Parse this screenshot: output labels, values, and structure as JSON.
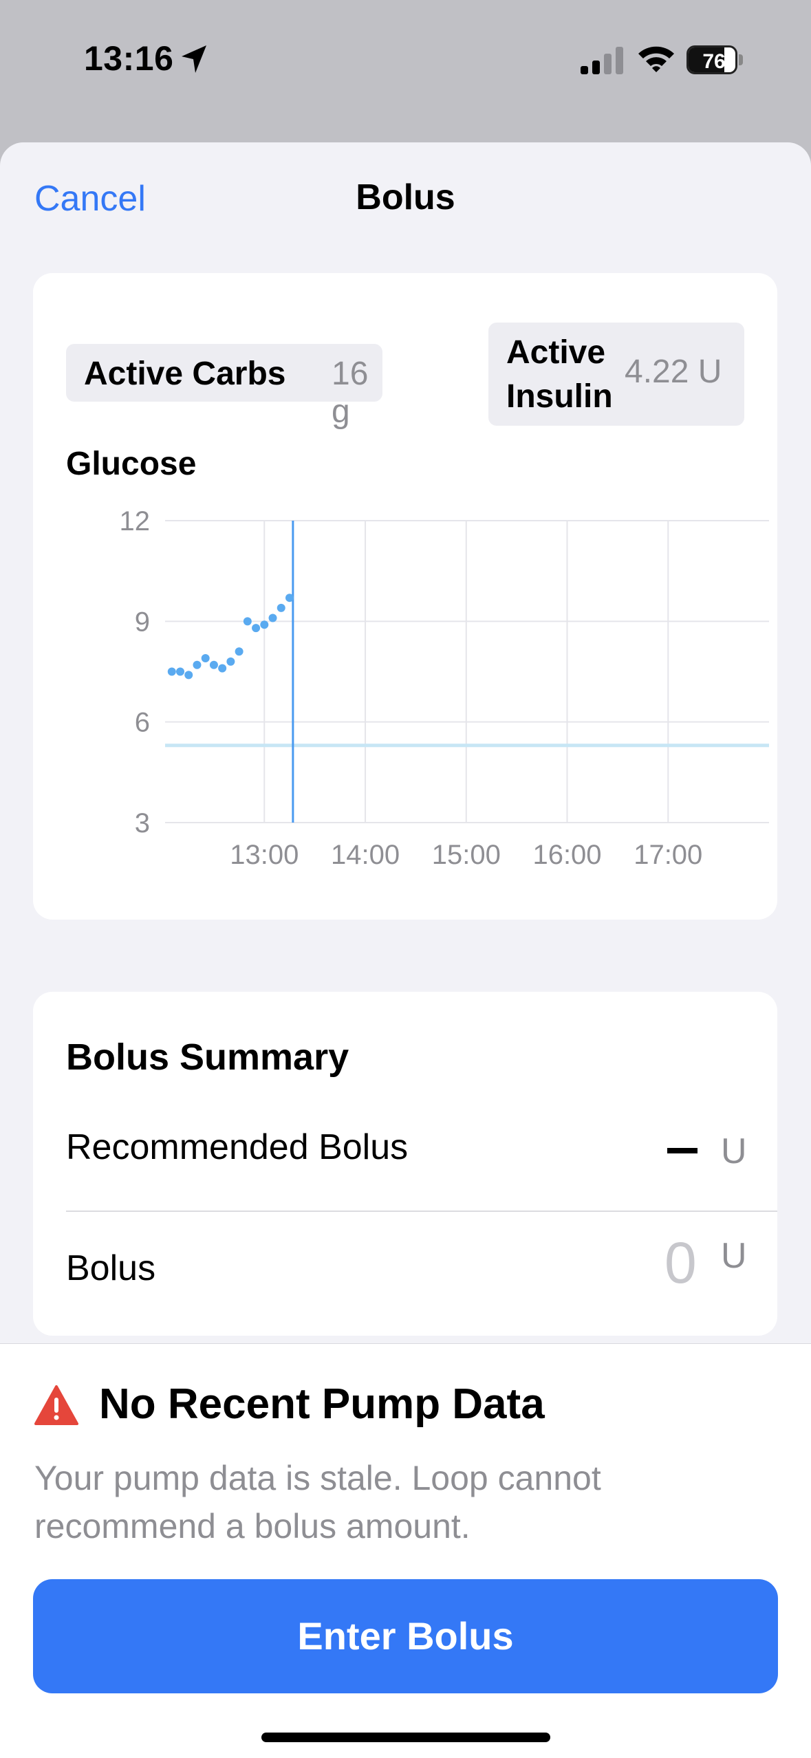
{
  "status_bar": {
    "time": "13:16",
    "battery_level": 76,
    "battery_text": "76",
    "signal_bars_active": 2,
    "signal_bars_total": 4,
    "location_icon": "location-arrow-icon",
    "wifi_icon": "wifi-icon"
  },
  "nav": {
    "cancel_label": "Cancel",
    "title": "Bolus"
  },
  "overview": {
    "active_carbs_label": "Active Carbs",
    "active_carbs_value": "16 g",
    "active_insulin_label": "Active Insulin",
    "active_insulin_value": "4.22 U",
    "glucose_title": "Glucose"
  },
  "chart_data": {
    "type": "scatter",
    "title": "Glucose",
    "y_ticks": [
      "12",
      "9",
      "6",
      "3"
    ],
    "x_ticks": [
      "13:00",
      "14:00",
      "15:00",
      "16:00",
      "17:00"
    ],
    "xlim": [
      "12:01",
      "18:00"
    ],
    "ylim": [
      3,
      12
    ],
    "grid": true,
    "now_marker": "13:17",
    "target_range": 5.3,
    "series": [
      {
        "points": [
          [
            "12:05",
            7.5
          ],
          [
            "12:10",
            7.5
          ],
          [
            "12:15",
            7.4
          ],
          [
            "12:20",
            7.7
          ],
          [
            "12:25",
            7.9
          ],
          [
            "12:30",
            7.7
          ],
          [
            "12:35",
            7.6
          ],
          [
            "12:40",
            7.8
          ],
          [
            "12:45",
            8.1
          ],
          [
            "12:50",
            9.0
          ],
          [
            "12:55",
            8.8
          ],
          [
            "13:00",
            8.9
          ],
          [
            "13:05",
            9.1
          ],
          [
            "13:10",
            9.4
          ],
          [
            "13:15",
            9.7
          ]
        ]
      }
    ],
    "colors": {
      "points": "#5aaaf0",
      "now_line": "#4a9af0",
      "target": "#c7e6f5",
      "grid": "#e5e5ea"
    }
  },
  "summary": {
    "title": "Bolus Summary",
    "recommended_label": "Recommended Bolus",
    "recommended_value": "–",
    "recommended_unit": "U",
    "bolus_label": "Bolus",
    "bolus_value": "0",
    "bolus_unit": "U"
  },
  "warning": {
    "icon": "warning-triangle-icon",
    "title": "No Recent Pump Data",
    "body": "Your pump data is stale. Loop cannot recommend a bolus amount."
  },
  "actions": {
    "enter_bolus_label": "Enter Bolus"
  },
  "colors": {
    "accent": "#3478f6",
    "warning": "#e5463b"
  }
}
